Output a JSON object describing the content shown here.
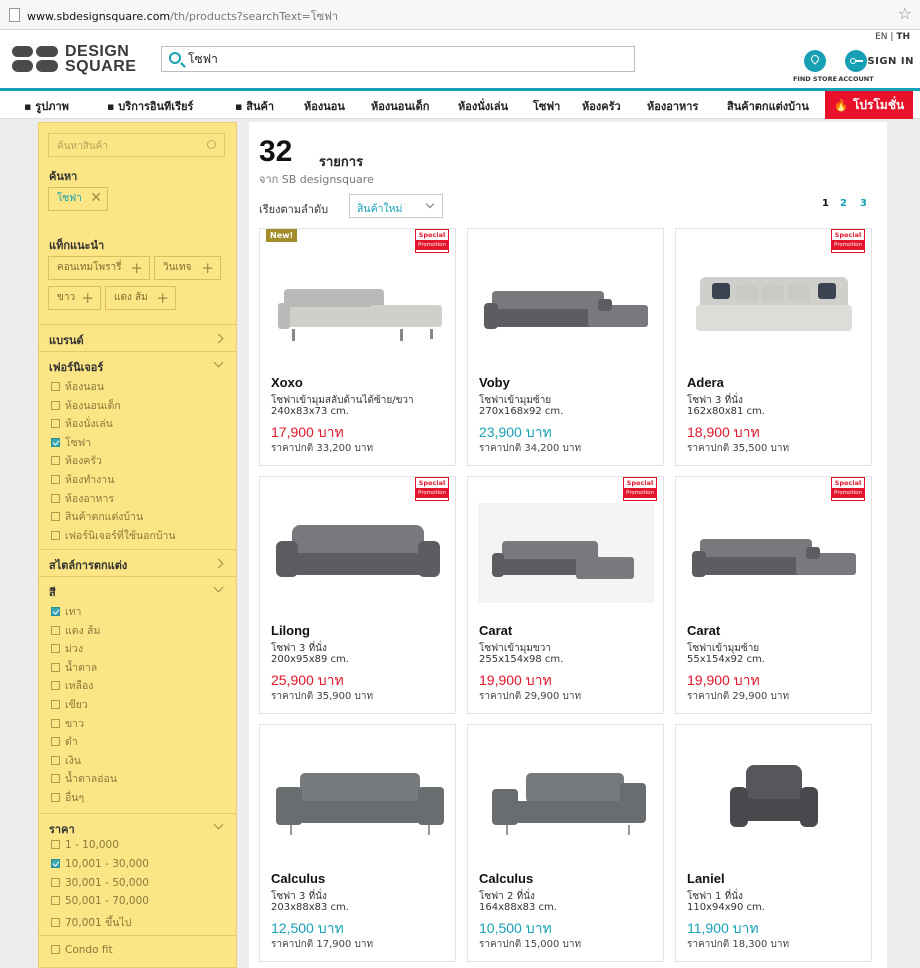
{
  "browser": {
    "url_host": "www.sbdesignsquare.com",
    "url_path": "/th/products?searchText=โซฟา"
  },
  "header": {
    "logo_line1": "DESIGN",
    "logo_line2": "SQUARE",
    "search_value": "โซฟา",
    "lang_en": "EN",
    "lang_sep": "|",
    "lang_th": "TH",
    "find_store": "FIND STORE",
    "account": "ACCOUNT",
    "sign_in": "SIGN IN",
    "accent_color": "#17a0b4"
  },
  "nav": {
    "items": [
      "รูปภาพ",
      "บริการอินทีเรียร์",
      "สินค้า",
      "ห้องนอน",
      "ห้องนอนเด็ก",
      "ห้องนั่งเล่น",
      "โซฟา",
      "ห้องครัว",
      "ห้องอาหาร",
      "สินค้าตกแต่งบ้าน"
    ],
    "promo": "โปรโมชั่น",
    "promo_color": "#e8102a"
  },
  "sidebar": {
    "search_placeholder": "ค้นหาสินค้า",
    "search_title": "ค้นหา",
    "search_tag": "โซฟา",
    "suggest_title": "แท็กแนะนำ",
    "suggest_tags": [
      "คอนเทมโพรารี่",
      "วินเทจ",
      "ขาว",
      "แดง ส้ม"
    ],
    "brand_title": "แบรนด์",
    "furniture_title": "เฟอร์นิเจอร์",
    "furniture_items": [
      {
        "label": "ห้องนอน",
        "checked": false
      },
      {
        "label": "ห้องนอนเด็ก",
        "checked": false
      },
      {
        "label": "ห้องนั่งเล่น",
        "checked": false
      },
      {
        "label": "โซฟา",
        "checked": true
      },
      {
        "label": "ห้องครัว",
        "checked": false
      },
      {
        "label": "ห้องทำงาน",
        "checked": false
      },
      {
        "label": "ห้องอาหาร",
        "checked": false
      },
      {
        "label": "สินค้าตกแต่งบ้าน",
        "checked": false
      },
      {
        "label": "เฟอร์นิเจอร์ที่ใช้นอกบ้าน",
        "checked": false
      }
    ],
    "style_title": "สไตล์การตกแต่ง",
    "color_title": "สี",
    "color_items": [
      {
        "label": "เทา",
        "checked": true
      },
      {
        "label": "แดง ส้ม",
        "checked": false
      },
      {
        "label": "ม่วง",
        "checked": false
      },
      {
        "label": "น้ำตาล",
        "checked": false
      },
      {
        "label": "เหลือง",
        "checked": false
      },
      {
        "label": "เขียว",
        "checked": false
      },
      {
        "label": "ขาว",
        "checked": false
      },
      {
        "label": "ดำ",
        "checked": false
      },
      {
        "label": "เงิน",
        "checked": false
      },
      {
        "label": "น้ำตาลอ่อน",
        "checked": false
      },
      {
        "label": "อื่นๆ",
        "checked": false
      }
    ],
    "price_title": "ราคา",
    "price_items": [
      {
        "label": "1 - 10,000",
        "checked": false
      },
      {
        "label": "10,001 - 30,000",
        "checked": true
      },
      {
        "label": "30,001 - 50,000",
        "checked": false
      },
      {
        "label": "50,001 - 70,000",
        "checked": false
      },
      {
        "label": "70,001 ขึ้นไป",
        "checked": false
      }
    ],
    "condo_fit": "Condo fit"
  },
  "results": {
    "count": "32",
    "count_label": "รายการ",
    "from": "จาก SB designsquare",
    "sort_label": "เรียงตามลำดับ",
    "sort_value": "สินค้าใหม่",
    "pages": [
      "1",
      "2",
      "3"
    ],
    "current_page": "1"
  },
  "badges": {
    "new": "New!",
    "special": "Special",
    "promotion": "Promotion"
  },
  "products": [
    {
      "name": "Xoxo",
      "desc": "โซฟาเข้ามุมสลับด้านได้ซ้าย/ขวา",
      "dims": "240x83x73 cm.",
      "price": "17,900 บาท",
      "price_color": "red",
      "regular": "ราคาปกติ 33,200 บาท",
      "new": true,
      "special": true,
      "icon": "sofa-l-shape-light"
    },
    {
      "name": "Voby",
      "desc": "โซฟาเข้ามุมซ้าย",
      "dims": "270x168x92 cm.",
      "price": "23,900 บาท",
      "price_color": "teal",
      "regular": "ราคาปกติ 34,200 บาท",
      "new": false,
      "special": false,
      "icon": "sofa-l-shape-dark"
    },
    {
      "name": "Adera",
      "desc": "โซฟา 3 ที่นั่ง",
      "dims": "162x80x81 cm.",
      "price": "18,900 บาท",
      "price_color": "red",
      "regular": "ราคาปกติ 35,500 บาท",
      "new": false,
      "special": true,
      "icon": "sofa-3-seat-light"
    },
    {
      "name": "Lilong",
      "desc": "โซฟา 3 ที่นั่ง",
      "dims": "200x95x89 cm.",
      "price": "25,900 บาท",
      "price_color": "red",
      "regular": "ราคาปกติ 35,900 บาท",
      "new": false,
      "special": true,
      "icon": "sofa-3-seat-dark"
    },
    {
      "name": "Carat",
      "desc": "โซฟาเข้ามุมขวา",
      "dims": "255x154x98 cm.",
      "price": "19,900 บาท",
      "price_color": "red",
      "regular": "ราคาปกติ 29,900 บาท",
      "new": false,
      "special": true,
      "icon": "sofa-l-shape-room"
    },
    {
      "name": "Carat",
      "desc": "โซฟาเข้ามุมซ้าย",
      "dims": "55x154x92 cm.",
      "price": "19,900 บาท",
      "price_color": "red",
      "regular": "ราคาปกติ 29,900 บาท",
      "new": false,
      "special": true,
      "icon": "sofa-l-shape-dark"
    },
    {
      "name": "Calculus",
      "desc": "โซฟา 3 ที่นั่ง",
      "dims": "203x88x83 cm.",
      "price": "12,500 บาท",
      "price_color": "teal",
      "regular": "ราคาปกติ 17,900 บาท",
      "new": false,
      "special": false,
      "icon": "sofa-3-seat-fabric"
    },
    {
      "name": "Calculus",
      "desc": "โซฟา 2 ที่นั่ง",
      "dims": "164x88x83 cm.",
      "price": "10,500 บาท",
      "price_color": "teal",
      "regular": "ราคาปกติ 15,000 บาท",
      "new": false,
      "special": false,
      "icon": "sofa-2-seat-fabric"
    },
    {
      "name": "Laniel",
      "desc": "โซฟา 1 ที่นั่ง",
      "dims": "110x94x90 cm.",
      "price": "11,900 บาท",
      "price_color": "teal",
      "regular": "ราคาปกติ 18,300 บาท",
      "new": false,
      "special": false,
      "icon": "armchair"
    }
  ]
}
